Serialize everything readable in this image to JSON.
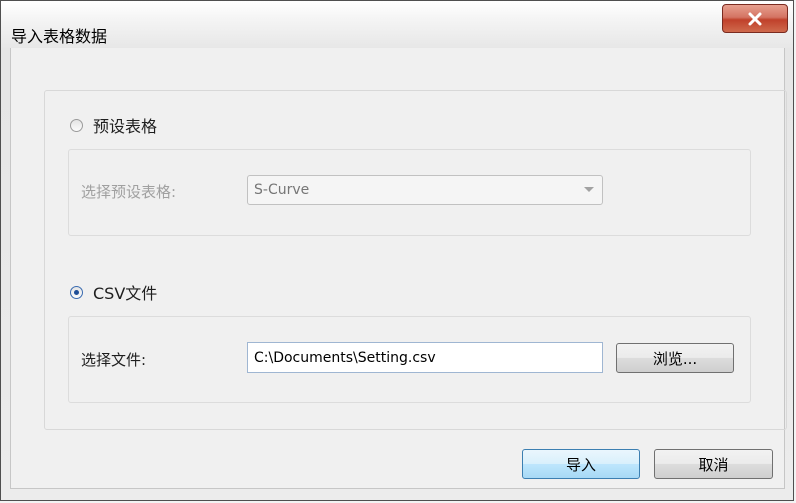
{
  "window": {
    "title": "导入表格数据",
    "close_glyph": "X"
  },
  "preset": {
    "radio_label": "预设表格",
    "selected": false,
    "field_label": "选择预设表格:",
    "combo_value": "S-Curve"
  },
  "csv": {
    "radio_label": "CSV文件",
    "selected": true,
    "field_label": "选择文件:",
    "file_path": "C:\\Documents\\Setting.csv",
    "browse_label": "浏览..."
  },
  "footer": {
    "import_label": "导入",
    "cancel_label": "取消"
  },
  "colors": {
    "close_button": "#c0412b",
    "default_button_border": "#3c7fb1"
  }
}
